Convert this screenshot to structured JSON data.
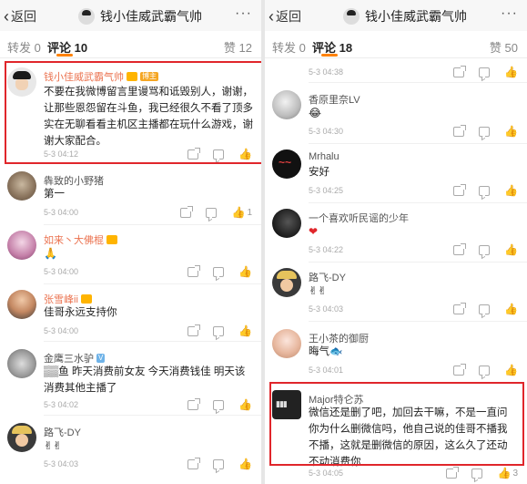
{
  "left": {
    "nav": {
      "back": "返回",
      "title": "钱小佳威武霸气帅",
      "more": "···"
    },
    "tabs": {
      "repost": "转发 0",
      "comments": "评论 10",
      "likes": "赞 12"
    },
    "comments": [
      {
        "name": "钱小佳威武霸气帅",
        "badge": "博主",
        "text": "不要在我微博留言里谩骂和诋毁别人，谢谢，让那些恩怨留在斗鱼，我已经很久不看了顶多实在无聊看看主机区主播都在玩什么游戏，谢谢大家配合。",
        "time": "5-3 04:12",
        "likes": ""
      },
      {
        "name": "犇致的小野猪",
        "text": "第一",
        "time": "5-3 04:00",
        "likes": "1"
      },
      {
        "name": "如来丶大佛棍",
        "text": "🙏",
        "time": "5-3 04:00",
        "likes": ""
      },
      {
        "name": "张雪峰ii",
        "text": "佳哥永远支持你",
        "time": "5-3 04:00",
        "likes": ""
      },
      {
        "name": "金鹰三水驴",
        "text": "▒▒鱼 昨天消费前女友 今天消费钱佳 明天该消费其他主播了",
        "time": "5-3 04:02",
        "likes": ""
      },
      {
        "name": "路飞-DY",
        "text": "✌✌",
        "time": "5-3 04:03",
        "likes": ""
      }
    ]
  },
  "right": {
    "nav": {
      "back": "返回",
      "title": "钱小佳威武霸气帅",
      "more": "···"
    },
    "tabs": {
      "repost": "转发 0",
      "comments": "评论 18",
      "likes": "赞 50"
    },
    "comments": [
      {
        "time": "5-3 04:38"
      },
      {
        "name": "香原里奈LV",
        "text": "😂",
        "time": "5-3 04:30"
      },
      {
        "name": "Mrhalu",
        "text": "安好",
        "time": "5-3 04:25"
      },
      {
        "name": "一个喜欢听民谣的少年",
        "text": "❤",
        "time": "5-3 04:22"
      },
      {
        "name": "路飞-DY",
        "text": "✌✌",
        "time": "5-3 04:03"
      },
      {
        "name": "王小茶的御厨",
        "text": "晦气🐟",
        "time": "5-3 04:01"
      },
      {
        "name": "Major特仑苏",
        "text": "微信还是删了吧，加回去干嘛，不是一直问你为什么删微信吗，他自己说的佳哥不播我不播，这就是删微信的原因，这么久了还动不动消费你",
        "time": "5-3 04:05",
        "likes": "3"
      }
    ]
  },
  "colors": {
    "accent": "#ff8200",
    "name": "#eb7350",
    "highlight_box": "#e0262b"
  }
}
